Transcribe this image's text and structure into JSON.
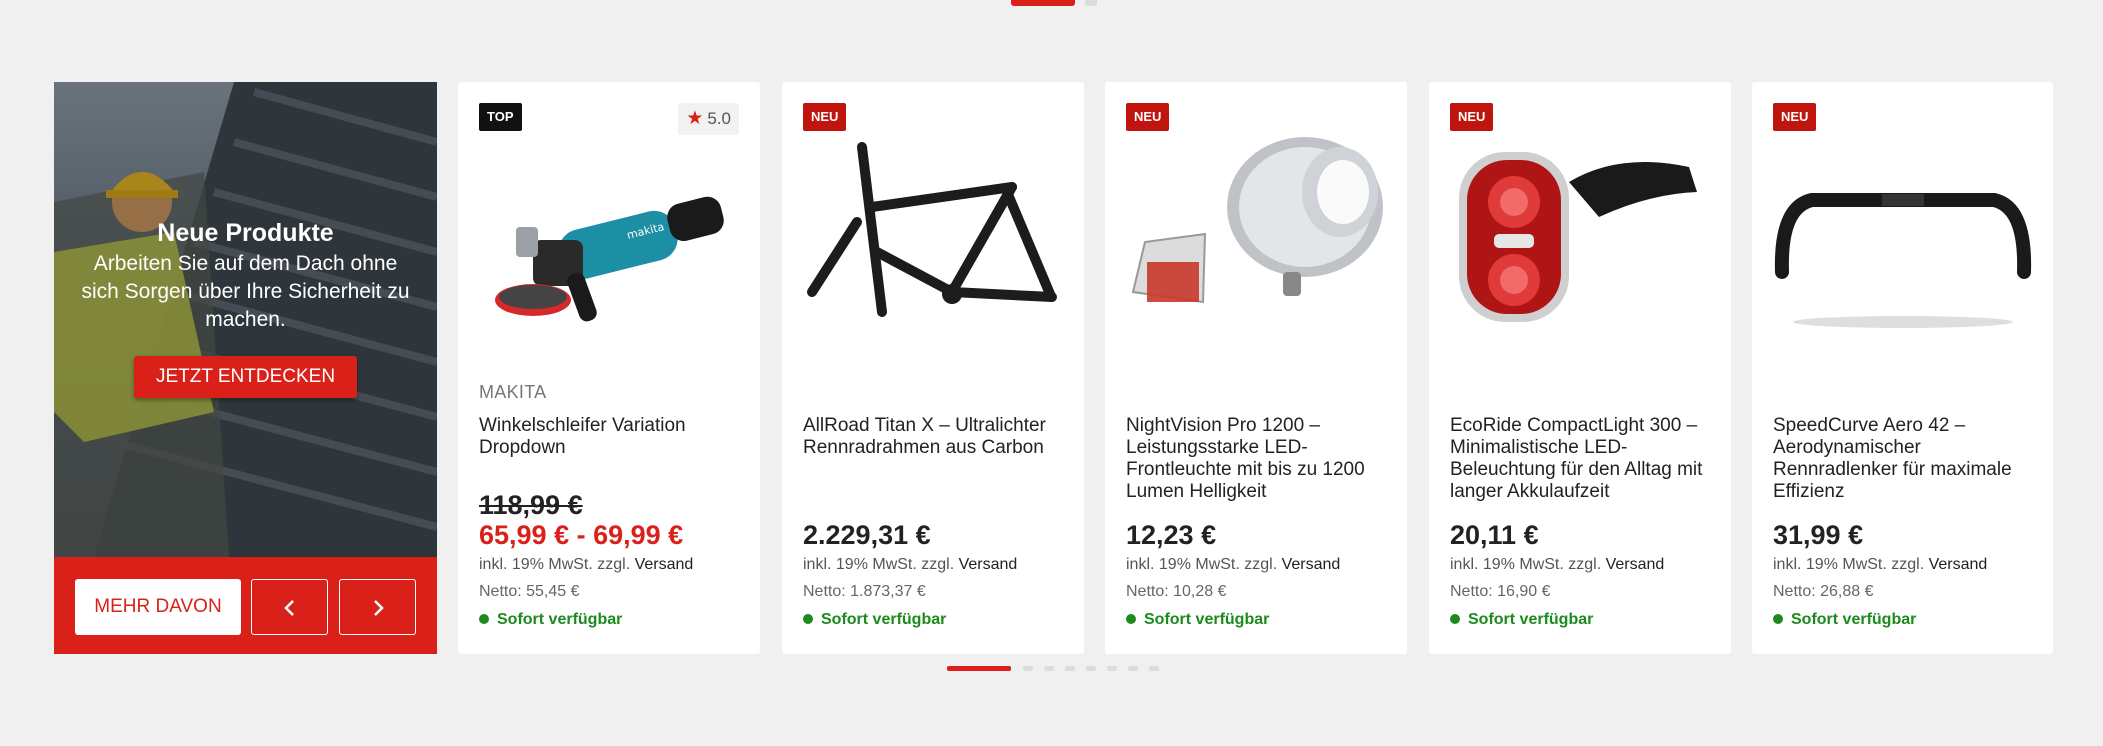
{
  "colors": {
    "accent": "#d9211a",
    "badge_top": "#111111",
    "badge_new": "#c0150e",
    "in_stock": "#1d8a1d",
    "background": "#f0f0f0"
  },
  "top_pager": {
    "pages": 2,
    "active": 1
  },
  "promo": {
    "title": "Neue Produkte",
    "text": "Arbeiten Sie auf dem Dach ohne sich Sorgen über Ihre Sicherheit zu machen.",
    "cta_label": "JETZT ENTDECKEN",
    "more_label": "MEHR DAVON",
    "prev_icon": "chevron-left-icon",
    "next_icon": "chevron-right-icon"
  },
  "products": [
    {
      "badge": "TOP",
      "rating": "5.0",
      "brand": "MAKITA",
      "name": "Winkelschleifer Variation Dropdown",
      "old_price": "118,99 €",
      "price": "65,99 € - 69,99 €",
      "tax": "inkl. 19% MwSt. zzgl.",
      "shipping": "Versand",
      "netto": "Netto: 55,45 €",
      "stock": "Sofort verfügbar",
      "image": "angle-grinder-image"
    },
    {
      "badge": "NEU",
      "name": "AllRoad Titan X – Ultralichter Rennradrahmen aus Carbon",
      "price": "2.229,31 €",
      "tax": "inkl. 19% MwSt. zzgl.",
      "shipping": "Versand",
      "netto": "Netto: 1.873,37 €",
      "stock": "Sofort verfügbar",
      "image": "bike-frame-image"
    },
    {
      "badge": "NEU",
      "name": "NightVision Pro 1200 – Leistungsstarke LED-Frontleuchte mit bis zu 1200 Lumen Helligkeit",
      "price": "12,23 €",
      "tax": "inkl. 19% MwSt. zzgl.",
      "shipping": "Versand",
      "netto": "Netto: 10,28 €",
      "stock": "Sofort verfügbar",
      "image": "bike-lights-image"
    },
    {
      "badge": "NEU",
      "name": "EcoRide CompactLight 300 – Minimalistische LED-Beleuchtung für den Alltag mit langer Akkulaufzeit",
      "price": "20,11 €",
      "tax": "inkl. 19% MwSt. zzgl.",
      "shipping": "Versand",
      "netto": "Netto: 16,90 €",
      "stock": "Sofort verfügbar",
      "image": "rear-light-image"
    },
    {
      "badge": "NEU",
      "name": "SpeedCurve Aero 42 – Aerodynamischer Rennradlenker für maximale Effizienz",
      "price": "31,99 €",
      "tax": "inkl. 19% MwSt. zzgl.",
      "shipping": "Versand",
      "netto": "Netto: 26,88 €",
      "stock": "Sofort verfügbar",
      "image": "handlebar-image"
    }
  ],
  "bottom_pager": {
    "pages": 8,
    "active": 1
  }
}
